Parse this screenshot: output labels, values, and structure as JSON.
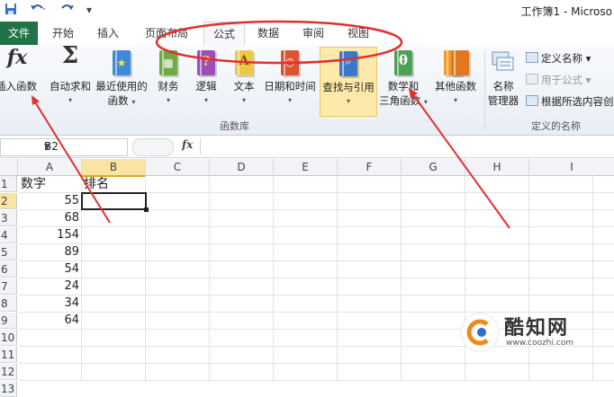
{
  "window": {
    "title": "工作簿1 - Microso"
  },
  "quick_access": {
    "icons": [
      "save-icon",
      "undo-icon",
      "redo-icon",
      "customize-icon"
    ]
  },
  "tabs": [
    {
      "label": "文件"
    },
    {
      "label": "开始"
    },
    {
      "label": "插入"
    },
    {
      "label": "页面布局"
    },
    {
      "label": "公式",
      "active": true
    },
    {
      "label": "数据"
    },
    {
      "label": "审阅"
    },
    {
      "label": "视图"
    }
  ],
  "ribbon": {
    "insert_function": {
      "icon_text": "fx",
      "label": "插入函数"
    },
    "autosum": {
      "icon_text": "Σ",
      "label": "自动求和"
    },
    "recent": {
      "label_line1": "最近使用的",
      "label_line2": "函数"
    },
    "financial": {
      "label": "财务"
    },
    "logical": {
      "label": "逻辑"
    },
    "text": {
      "label": "文本"
    },
    "datetime": {
      "label": "日期和时间"
    },
    "lookup": {
      "label": "查找与引用"
    },
    "math": {
      "label_line1": "数学和",
      "label_line2": "三角函数",
      "icon_text": "θ"
    },
    "other": {
      "label": "其他函数"
    },
    "library_group": "函数库",
    "name_manager": {
      "label_line1": "名称",
      "label_line2": "管理器"
    },
    "define_name": "定义名称",
    "use_in_formula": "用于公式",
    "create_from_selection": "根据所选内容创建",
    "defined_names_group": "定义的名称",
    "colors": {
      "file_tab": "#217346",
      "annotation": "#e03030",
      "selected_button": "#fde9a9"
    }
  },
  "formula_bar": {
    "name_box": "B2",
    "fx": "fx",
    "value": ""
  },
  "sheet": {
    "columns": [
      "A",
      "B",
      "C",
      "D",
      "E",
      "F",
      "G",
      "H",
      "I"
    ],
    "rows": [
      "1",
      "2",
      "3",
      "4",
      "5",
      "6",
      "7",
      "8",
      "9",
      "10",
      "11",
      "12",
      "13"
    ],
    "selected_cell": "B2",
    "cells": {
      "A1": "数字",
      "B1": "排名",
      "A2": "55",
      "A3": "68",
      "A4": "154",
      "A5": "89",
      "A6": "54",
      "A7": "24",
      "A8": "34",
      "A9": "64"
    }
  },
  "watermark": {
    "brand": "酷知网",
    "url": "www.coozhi.com"
  }
}
